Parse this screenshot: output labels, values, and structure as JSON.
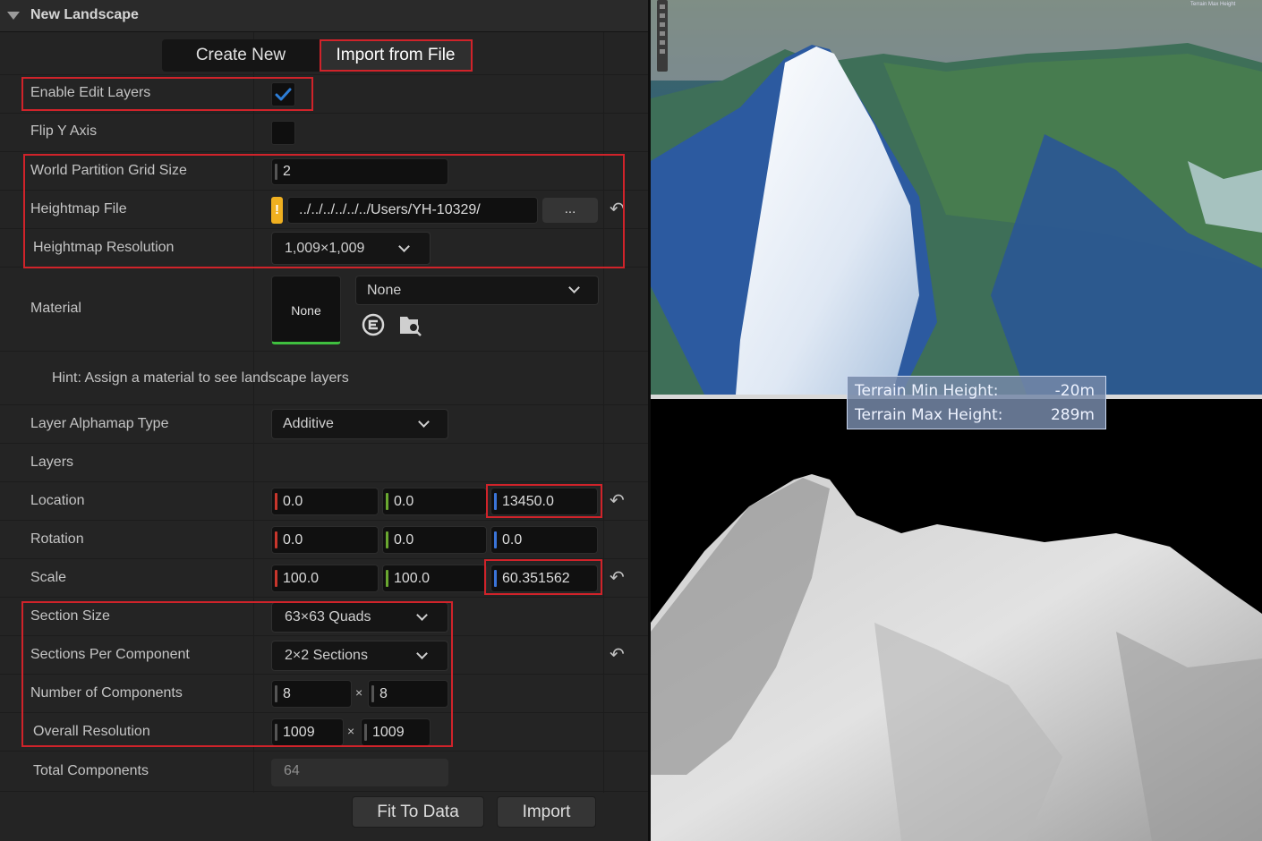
{
  "panel": {
    "title": "New Landscape",
    "tabs": {
      "create_new": "Create New",
      "import_from_file": "Import from File"
    },
    "enable_edit_layers": {
      "label": "Enable Edit Layers",
      "checked": true
    },
    "flip_y_axis": {
      "label": "Flip Y Axis",
      "checked": false
    },
    "world_partition_grid_size": {
      "label": "World Partition Grid Size",
      "value": "2"
    },
    "heightmap_file": {
      "label": "Heightmap File",
      "warning": "!",
      "value": "../../../../../../Users/YH-10329/",
      "browse": "..."
    },
    "heightmap_resolution": {
      "label": "Heightmap Resolution",
      "value": "1,009×1,009"
    },
    "material": {
      "label": "Material",
      "thumb": "None",
      "value": "None"
    },
    "hint": "Hint: Assign a material to see landscape layers",
    "layer_alphamap_type": {
      "label": "Layer Alphamap Type",
      "value": "Additive"
    },
    "layers": {
      "label": "Layers"
    },
    "location": {
      "label": "Location",
      "x": "0.0",
      "y": "0.0",
      "z": "13450.0"
    },
    "rotation": {
      "label": "Rotation",
      "x": "0.0",
      "y": "0.0",
      "z": "0.0"
    },
    "scale": {
      "label": "Scale",
      "x": "100.0",
      "y": "100.0",
      "z": "60.351562"
    },
    "section_size": {
      "label": "Section Size",
      "value": "63×63 Quads"
    },
    "sections_per_component": {
      "label": "Sections Per Component",
      "value": "2×2 Sections"
    },
    "number_of_components": {
      "label": "Number of Components",
      "x": "8",
      "y": "8",
      "sep": "×"
    },
    "overall_resolution": {
      "label": "Overall Resolution",
      "x": "1009",
      "y": "1009",
      "sep": "×"
    },
    "total_components": {
      "label": "Total Components",
      "value": "64"
    },
    "buttons": {
      "fit_to_data": "Fit To Data",
      "import": "Import"
    }
  },
  "viewport": {
    "terrain_min_label": "Terrain Min Height:",
    "terrain_min_value": "-20m",
    "terrain_max_label": "Terrain Max Height:",
    "terrain_max_value": "289m",
    "corner_text": "Terrain Max Height"
  },
  "colors": {
    "highlight": "#d0232a",
    "axis_x": "#c8362c",
    "axis_y": "#6aa830",
    "axis_z": "#3a74d8",
    "accent": "#2d7dd6",
    "warning": "#f0b020"
  }
}
